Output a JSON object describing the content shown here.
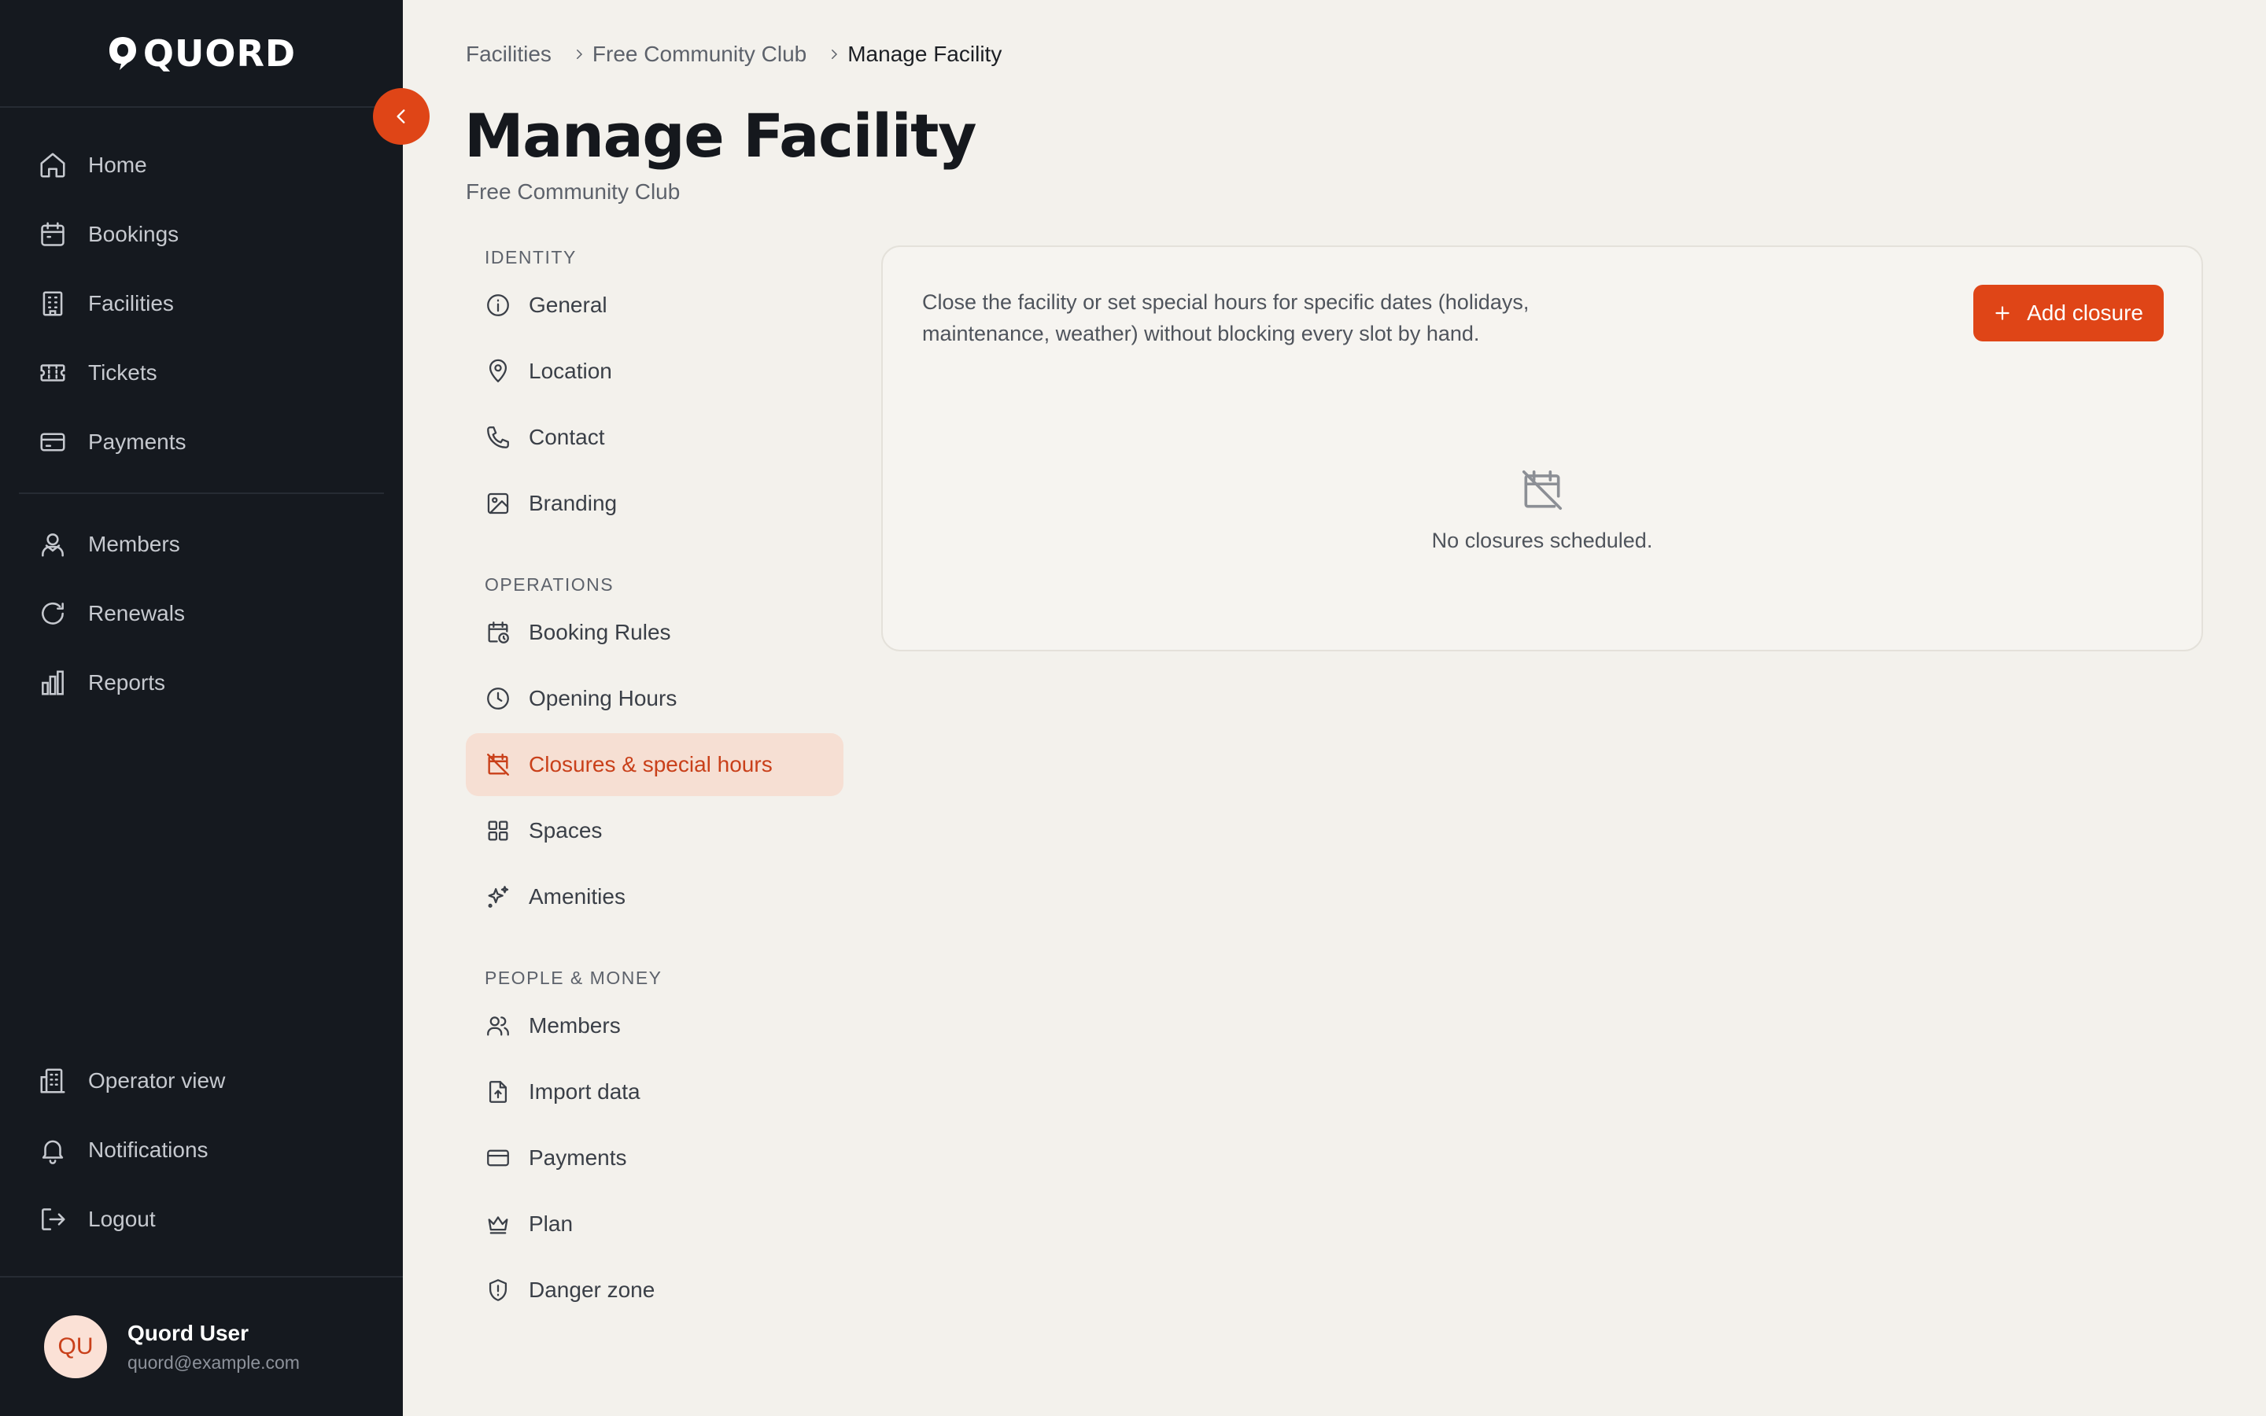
{
  "app": {
    "logo_text": "QUORD"
  },
  "sidebar": {
    "primary": [
      {
        "label": "Home",
        "icon": "home-icon"
      },
      {
        "label": "Bookings",
        "icon": "calendar-icon"
      },
      {
        "label": "Facilities",
        "icon": "building-icon"
      },
      {
        "label": "Tickets",
        "icon": "ticket-icon"
      },
      {
        "label": "Payments",
        "icon": "credit-card-icon"
      }
    ],
    "secondary": [
      {
        "label": "Members",
        "icon": "users-icon"
      },
      {
        "label": "Renewals",
        "icon": "refresh-icon"
      },
      {
        "label": "Reports",
        "icon": "bar-chart-icon"
      }
    ],
    "bottom": [
      {
        "label": "Operator view",
        "icon": "office-building-icon"
      },
      {
        "label": "Notifications",
        "icon": "bell-icon"
      },
      {
        "label": "Logout",
        "icon": "logout-icon"
      }
    ],
    "user": {
      "initials": "QU",
      "name": "Quord User",
      "email": "quord@example.com"
    }
  },
  "breadcrumb": [
    "Facilities",
    "Free Community Club",
    "Manage Facility"
  ],
  "page": {
    "title": "Manage Facility",
    "subtitle": "Free Community Club"
  },
  "subnav": {
    "sections": [
      {
        "label": "IDENTITY",
        "items": [
          "General",
          "Location",
          "Contact",
          "Branding"
        ]
      },
      {
        "label": "OPERATIONS",
        "items": [
          "Booking Rules",
          "Opening Hours",
          "Closures & special hours",
          "Spaces",
          "Amenities"
        ]
      },
      {
        "label": "PEOPLE & MONEY",
        "items": [
          "Members",
          "Import data",
          "Payments",
          "Plan",
          "Danger zone"
        ]
      }
    ],
    "active": "Closures & special hours"
  },
  "closures": {
    "description": "Close the facility or set special hours for specific dates (holidays, maintenance, weather) without blocking every slot by hand.",
    "add_button": "Add closure",
    "empty_text": "No closures scheduled."
  },
  "colors": {
    "accent": "#df4517",
    "sidebar_bg": "#15191f",
    "page_bg": "#f3f1ec",
    "active_bg": "#f6dfd3"
  }
}
